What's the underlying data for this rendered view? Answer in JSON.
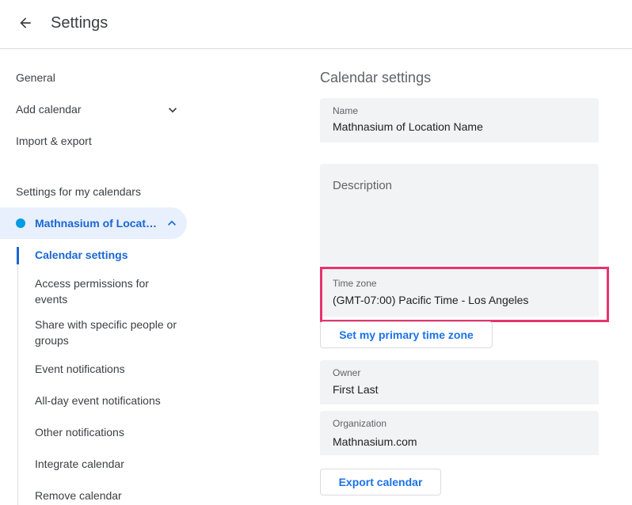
{
  "header": {
    "title": "Settings",
    "back_icon": "arrow-back-icon"
  },
  "sidebar": {
    "general": "General",
    "add_calendar": "Add calendar",
    "import_export": "Import & export",
    "my_calendars_heading": "Settings for my calendars",
    "calendar": {
      "name": "Mathnasium of Location Name",
      "dot_color": "#039be5"
    },
    "sub_items": [
      "Calendar settings",
      "Access permissions for events",
      "Share with specific people or groups",
      "Event notifications",
      "All-day event notifications",
      "Other notifications",
      "Integrate calendar",
      "Remove calendar"
    ]
  },
  "main": {
    "title": "Calendar settings",
    "name_field": {
      "label": "Name",
      "value": "Mathnasium of Location Name"
    },
    "description_field": {
      "placeholder": "Description"
    },
    "timezone_field": {
      "label": "Time zone",
      "value": "(GMT-07:00) Pacific Time - Los Angeles"
    },
    "primary_tz_button": "Set my primary time zone",
    "owner_field": {
      "label": "Owner",
      "value": "First Last"
    },
    "organization_field": {
      "label": "Organization",
      "value": "Mathnasium.com"
    },
    "export_button": "Export calendar"
  },
  "colors": {
    "accent": "#1a73e8",
    "active_nav": "#1967d2",
    "highlight": "#e8336d"
  }
}
